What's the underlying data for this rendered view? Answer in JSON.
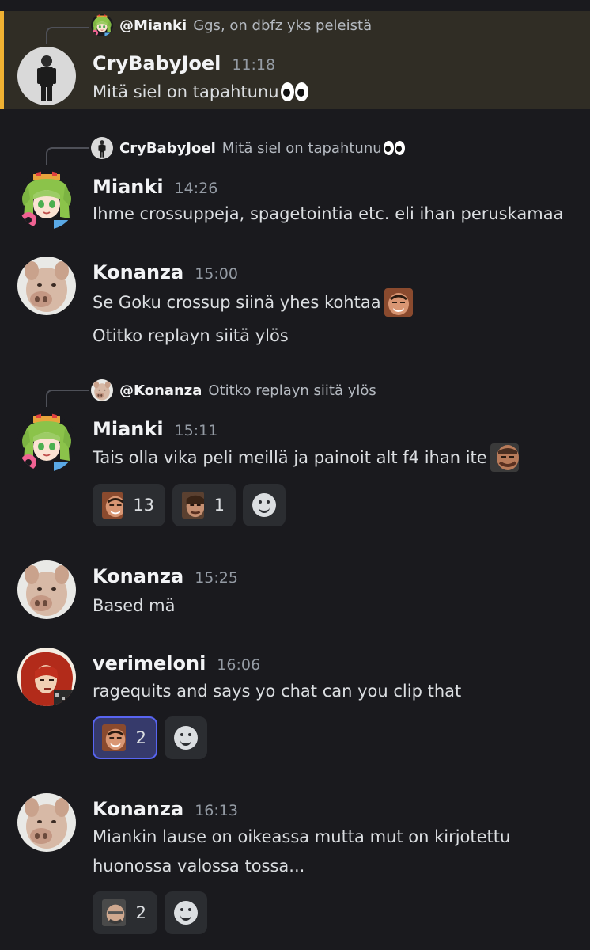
{
  "messages": [
    {
      "reply": {
        "name": "@Mianki",
        "text": "Ggs, on dbfz yks peleistä"
      },
      "author": "CryBabyJoel",
      "time": "11:18",
      "lines": [
        "Mitä siel on tapahtunu"
      ],
      "highlighted": true
    },
    {
      "reply": {
        "name": "CryBabyJoel",
        "text": "Mitä siel on tapahtunu"
      },
      "author": "Mianki",
      "time": "14:26",
      "lines": [
        "Ihme crossuppeja, spagetointia etc. eli ihan peruskamaa"
      ]
    },
    {
      "author": "Konanza",
      "time": "15:00",
      "lines": [
        "Se Goku crossup siinä yhes kohtaa",
        "Otitko replayn siitä ylös"
      ]
    },
    {
      "reply": {
        "name": "@Konanza",
        "text": "Otitko replayn siitä ylös"
      },
      "author": "Mianki",
      "time": "15:11",
      "lines": [
        "Tais olla vika peli meillä ja painoit alt f4 ihan ite"
      ],
      "reactions": [
        {
          "count": "13"
        },
        {
          "count": "1"
        }
      ]
    },
    {
      "author": "Konanza",
      "time": "15:25",
      "lines": [
        "Based mä"
      ]
    },
    {
      "author": "verimeloni",
      "time": "16:06",
      "lines": [
        "ragequits and says yo chat can you clip that"
      ],
      "reactions": [
        {
          "count": "2"
        }
      ]
    },
    {
      "author": "Konanza",
      "time": "16:13",
      "lines": [
        "Miankin lause on oikeassa mutta mut on kirjotettu",
        "huonossa valossa tossa..."
      ],
      "reactions": [
        {
          "count": "2"
        }
      ]
    }
  ],
  "icons": {
    "add_reaction": "smile-plus-icon",
    "eyes": "eyes-emoji"
  },
  "colors": {
    "background": "#1a1a1e",
    "highlight_bg": "#302d25",
    "highlight_bar": "#f0b232",
    "reaction_bg": "#2b2d31",
    "reaction_active_border": "#5865f2"
  }
}
